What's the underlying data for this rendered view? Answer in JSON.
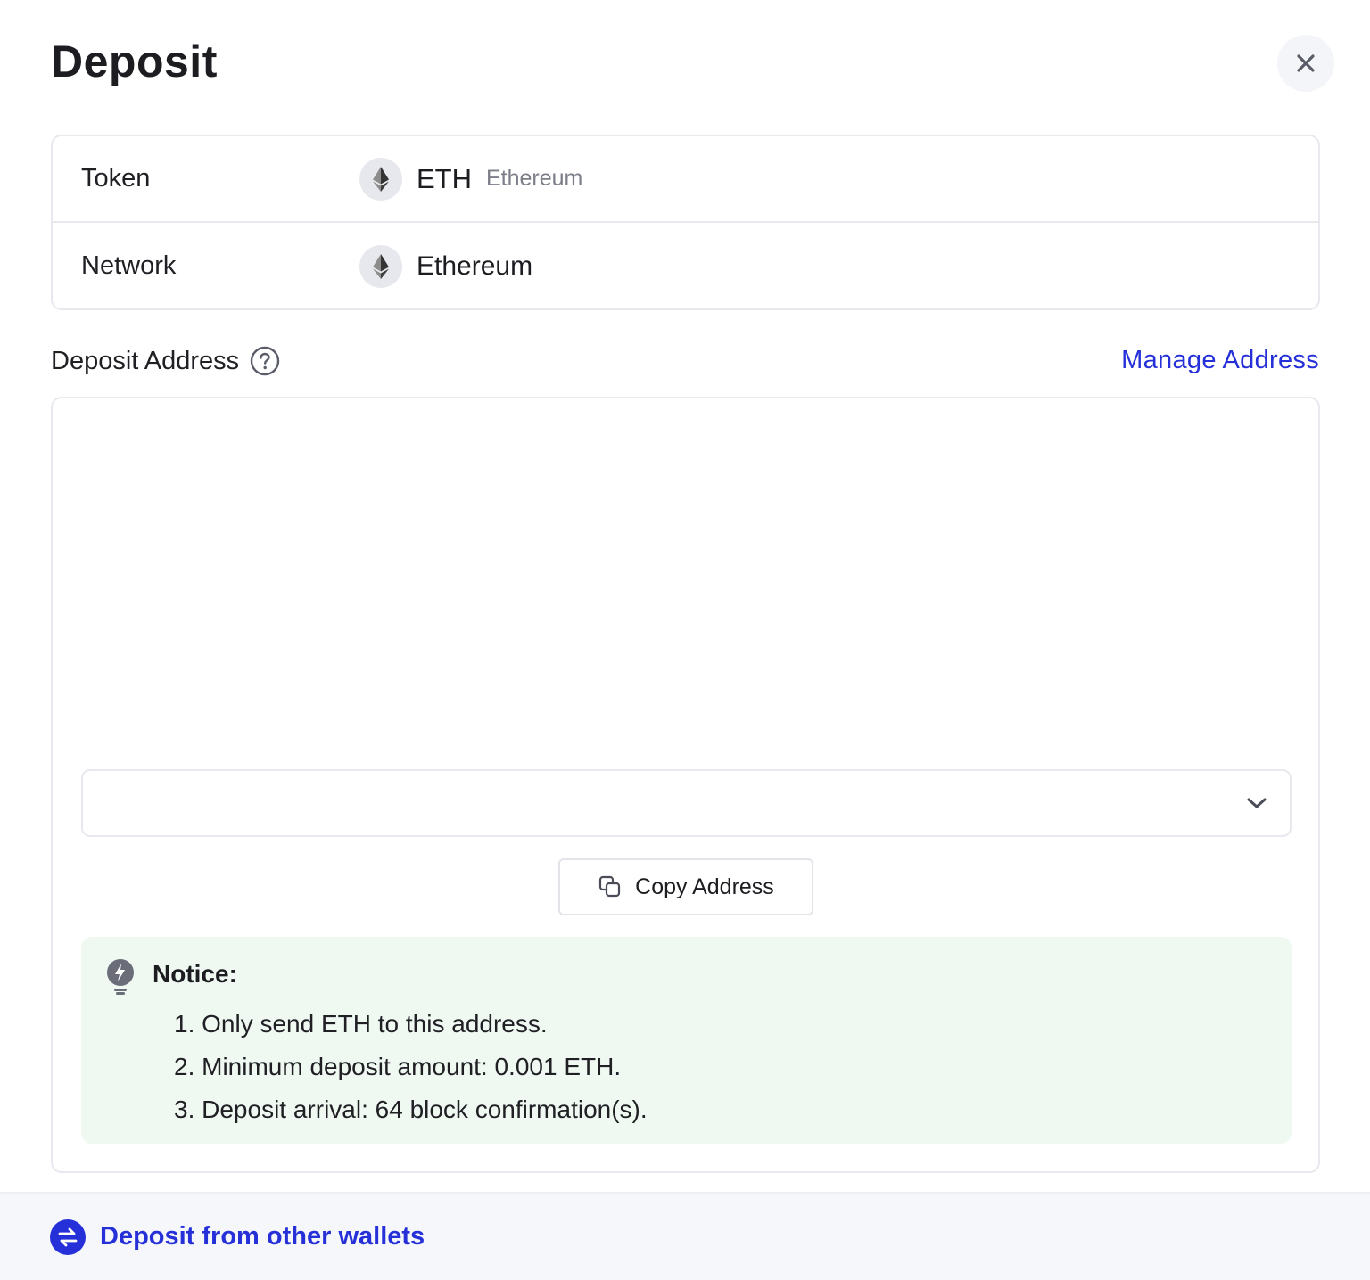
{
  "header": {
    "title": "Deposit",
    "close_icon": "close-icon"
  },
  "info": {
    "token_label": "Token",
    "token_symbol": "ETH",
    "token_name": "Ethereum",
    "network_label": "Network",
    "network_name": "Ethereum",
    "coin_icon": "ethereum-icon"
  },
  "address": {
    "label": "Deposit Address",
    "help_icon": "question-circle-icon",
    "manage_link": "Manage Address",
    "selected_value": "",
    "copy_button": "Copy Address"
  },
  "notice": {
    "title": "Notice:",
    "items": [
      "1. Only send ETH to this address.",
      "2. Minimum deposit amount: 0.001 ETH.",
      "3. Deposit arrival: 64 block confirmation(s)."
    ]
  },
  "footer": {
    "label": "Deposit from other wallets",
    "icon": "swap-arrows-icon"
  },
  "colors": {
    "accent": "#2530d8",
    "notice_bg": "#eff9f2",
    "border": "#e8e9ee"
  }
}
